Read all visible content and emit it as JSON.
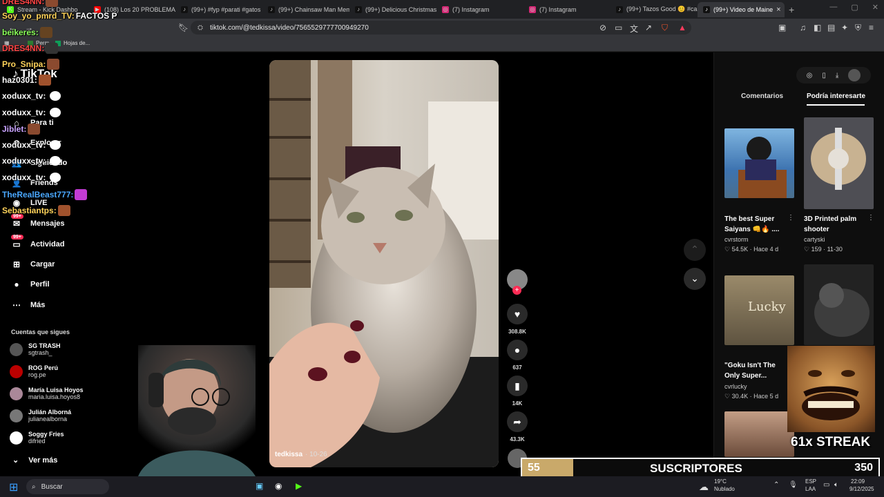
{
  "browser": {
    "tabs": [
      {
        "label": "Stream - Kick Dashbo",
        "fav": "K",
        "favcolor": "#53fc18"
      },
      {
        "label": "(108) Los 20 PROBLEMAS",
        "fav": "▶",
        "favcolor": "#ff0000"
      },
      {
        "label": "(99+) #fyp #parati #gatos",
        "fav": "♪",
        "favcolor": "#111"
      },
      {
        "label": "(99+) Chainsaw Man Mem",
        "fav": "♪",
        "favcolor": "#111"
      },
      {
        "label": "(99+) Delicious Christmas",
        "fav": "♪",
        "favcolor": "#111"
      },
      {
        "label": "(7) Instagram",
        "fav": "◎",
        "favcolor": "#d62976"
      },
      {
        "label": "(7) Instagram",
        "fav": "◎",
        "favcolor": "#d62976"
      },
      {
        "label": "(99+) Tazos Good 😊 #cab",
        "fav": "♪",
        "favcolor": "#111"
      },
      {
        "label": "(99+) Video de Maine",
        "fav": "♪",
        "favcolor": "#111",
        "active": true
      }
    ],
    "url": "tiktok.com/@tedkissa/video/7565529777700949270",
    "bookmarks": [
      "Perm",
      "Hojas de..."
    ]
  },
  "tiktok": {
    "logo": "TikTok",
    "nav": [
      {
        "label": "Para ti",
        "icon": "⌂"
      },
      {
        "label": "Explorar",
        "icon": "⊘"
      },
      {
        "label": "Siguiendo",
        "icon": "👥"
      },
      {
        "label": "Friends",
        "icon": "👤"
      },
      {
        "label": "LIVE",
        "icon": "◉"
      },
      {
        "label": "Mensajes",
        "icon": "✉",
        "badge": "99+"
      },
      {
        "label": "Actividad",
        "icon": "▭",
        "badge": "99+"
      },
      {
        "label": "Cargar",
        "icon": "⊞"
      },
      {
        "label": "Perfil",
        "icon": "●"
      },
      {
        "label": "Más",
        "icon": "⋯"
      }
    ],
    "following_title": "Cuentas que sigues",
    "following": [
      {
        "name": "SG TRASH",
        "handle": "sgtrash_",
        "color": "#555"
      },
      {
        "name": "ROG Perú",
        "handle": "rog.pe",
        "color": "#b00"
      },
      {
        "name": "María Luisa Hoyos",
        "handle": "maria.luisa.hoyos8",
        "color": "#a89"
      },
      {
        "name": "Julián Alborná",
        "handle": "julianealborna",
        "color": "#777"
      },
      {
        "name": "Soggy Fries",
        "handle": "difried",
        "color": "#fff"
      }
    ],
    "see_more": "Ver más",
    "video": {
      "author": "tedkissa",
      "date": "· 10-26"
    },
    "actions": [
      {
        "name": "like",
        "icon": "♥",
        "count": "308.8K"
      },
      {
        "name": "comment",
        "icon": "●",
        "count": "637"
      },
      {
        "name": "save",
        "icon": "▮",
        "count": "14K"
      },
      {
        "name": "share",
        "icon": "➦",
        "count": "43.3K"
      }
    ],
    "right_tabs": [
      "Comentarios",
      "Podría interesarte"
    ],
    "cards": [
      {
        "title": "The best Super Saiyans 👊🔥 ....",
        "author": "cvrstorm",
        "meta": "♡ 54.5K · Hace 4 d"
      },
      {
        "title": "3D Printed palm shooter",
        "author": "cartyski",
        "meta": "♡ 159 · 11-30"
      },
      {
        "title": "\"Goku Isn't The Only Super...",
        "author": "cvrlucky",
        "meta": "♡ 30.4K · Hace 5 d"
      },
      {
        "title": "Lucky",
        "author": "",
        "meta": ""
      }
    ]
  },
  "chat": [
    {
      "user": "DRES4NN:",
      "color": "#ff4444",
      "text": ""
    },
    {
      "user": "Soy_yo_pmrd_TV:",
      "color": "#ffd35a",
      "text": "FACTOS P"
    },
    {
      "user": "beikeres:",
      "color": "#8bff5a",
      "text": ""
    },
    {
      "user": "DRES4NN:",
      "color": "#ff4444",
      "text": ""
    },
    {
      "user": "Pro_Snipa:",
      "color": "#ffd35a",
      "text": ""
    },
    {
      "user": "haz0301:",
      "color": "#fff",
      "text": ""
    },
    {
      "user": "xoduxx_tv:",
      "color": "#fff",
      "text": ""
    },
    {
      "user": "xoduxx_tv:",
      "color": "#fff",
      "text": ""
    },
    {
      "user": "Jiblet:",
      "color": "#c9a3ff",
      "text": ""
    },
    {
      "user": "xoduxx_tv:",
      "color": "#fff",
      "text": ""
    },
    {
      "user": "xoduxx_tv:",
      "color": "#fff",
      "text": ""
    },
    {
      "user": "xoduxx_tv:",
      "color": "#fff",
      "text": ""
    },
    {
      "user": "TheRealBeast777:",
      "color": "#4aa8ff",
      "text": ""
    },
    {
      "user": "Sebastiantps:",
      "color": "#ffd35a",
      "text": ""
    }
  ],
  "stream": {
    "sub_count_left": "55",
    "sub_label": "SUSCRIPTORES",
    "sub_count_right": "350",
    "streak": "61x STREAK"
  },
  "taskbar": {
    "search": "Buscar",
    "weather_temp": "19°C",
    "weather_desc": "Nublado",
    "lang": "ESP",
    "lang2": "LAA",
    "time": "22:09",
    "date": "9/12/2025"
  }
}
